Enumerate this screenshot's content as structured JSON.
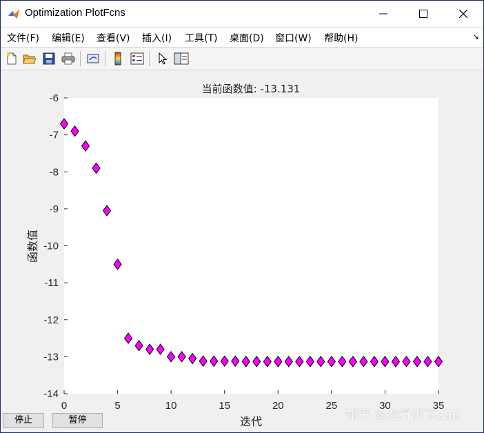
{
  "window": {
    "title": "Optimization PlotFcns"
  },
  "menu": {
    "items": [
      "文件(F)",
      "编辑(E)",
      "查看(V)",
      "插入(I)",
      "工具(T)",
      "桌面(D)",
      "窗口(W)",
      "帮助(H)"
    ],
    "overflow_icon": "dock-arrow-icon"
  },
  "toolbar": {
    "buttons": [
      "new-figure-icon",
      "open-file-icon",
      "save-icon",
      "print-icon",
      "link-icon",
      "colorbar-icon",
      "legend-icon",
      "pointer-icon",
      "property-editor-icon"
    ]
  },
  "chart_data": {
    "type": "scatter",
    "title": "当前函数值: -13.131",
    "xlabel": "迭代",
    "ylabel": "函数值",
    "xlim": [
      0,
      35
    ],
    "ylim": [
      -14,
      -6
    ],
    "xticks": [
      0,
      5,
      10,
      15,
      20,
      25,
      30,
      35
    ],
    "yticks": [
      -6,
      -7,
      -8,
      -9,
      -10,
      -11,
      -12,
      -13,
      -14
    ],
    "marker": "diamond",
    "marker_color": "#ff00ff",
    "series": [
      {
        "x": [
          0,
          1,
          2,
          3,
          4,
          5,
          6,
          7,
          8,
          9,
          10,
          11,
          12,
          13,
          14,
          15,
          16,
          17,
          18,
          19,
          20,
          21,
          22,
          23,
          24,
          25,
          26,
          27,
          28,
          29,
          30,
          31,
          32,
          33,
          34,
          35
        ],
        "y": [
          -6.7,
          -6.9,
          -7.3,
          -7.9,
          -9.05,
          -10.5,
          -12.5,
          -12.7,
          -12.8,
          -12.8,
          -13.0,
          -13.0,
          -13.05,
          -13.12,
          -13.12,
          -13.12,
          -13.12,
          -13.13,
          -13.13,
          -13.13,
          -13.13,
          -13.13,
          -13.13,
          -13.13,
          -13.13,
          -13.13,
          -13.13,
          -13.13,
          -13.13,
          -13.13,
          -13.13,
          -13.13,
          -13.13,
          -13.131,
          -13.131,
          -13.131
        ]
      }
    ]
  },
  "controls": {
    "stop_label": "停止",
    "pause_label": "暂停"
  },
  "watermark": "知乎 @龙行天下288"
}
